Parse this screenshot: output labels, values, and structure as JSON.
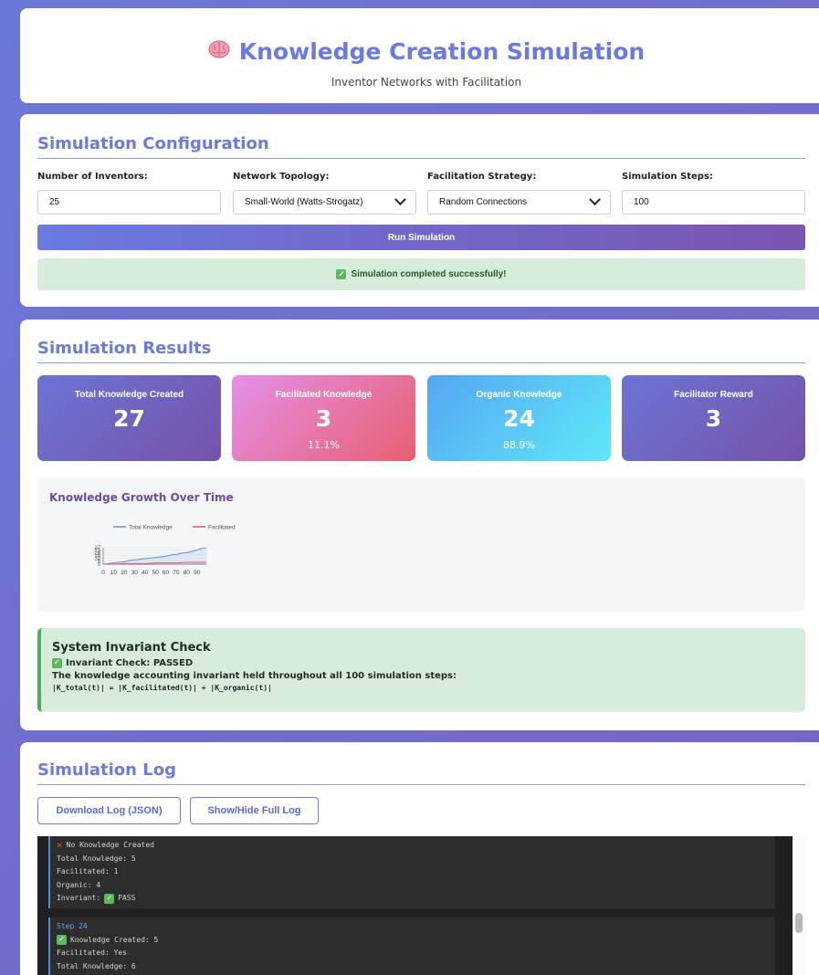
{
  "header": {
    "title": "Knowledge Creation Simulation",
    "subtitle": "Inventor Networks with Facilitation",
    "icon": "brain-icon"
  },
  "config": {
    "title": "Simulation Configuration",
    "fields": [
      {
        "label": "Number of Inventors:",
        "value": "25"
      },
      {
        "label": "Network Topology:",
        "value": "Small-World (Watts-Strogatz)"
      },
      {
        "label": "Facilitation Strategy:",
        "value": "Random Connections"
      },
      {
        "label": "Simulation Steps:",
        "value": "100"
      }
    ],
    "run_label": "Run Simulation",
    "status": "Simulation completed successfully!"
  },
  "results": {
    "title": "Simulation Results",
    "stats": [
      {
        "label": "Total Knowledge Created",
        "value": "27",
        "pct": ""
      },
      {
        "label": "Facilitated Knowledge",
        "value": "3",
        "pct": "11.1%"
      },
      {
        "label": "Organic Knowledge",
        "value": "24",
        "pct": "88.9%"
      },
      {
        "label": "Facilitator Reward",
        "value": "3",
        "pct": ""
      }
    ],
    "chart_title": "Knowledge Growth Over Time",
    "invariant": {
      "title": "System Invariant Check",
      "status": "Invariant Check: PASSED",
      "desc": "The knowledge accounting invariant held throughout all 100 simulation steps:",
      "formula": "|K_total(t)| = |K_facilitated(t)| + |K_organic(t)|"
    }
  },
  "chart_data": {
    "type": "line",
    "title": "Knowledge Growth Over Time",
    "xlabel": "",
    "ylabel": "",
    "x_ticks": [
      "0",
      "10",
      "20",
      "30",
      "40",
      "50",
      "60",
      "70",
      "80",
      "90"
    ],
    "y_ticks": [
      "0",
      "5",
      "10",
      "14",
      "18",
      "23",
      "27"
    ],
    "xlim": [
      0,
      99
    ],
    "ylim": [
      0,
      27
    ],
    "legend_position": "top",
    "series": [
      {
        "name": "Total Knowledge",
        "color": "#5b8def",
        "x": [
          0,
          5,
          10,
          15,
          20,
          25,
          30,
          35,
          40,
          45,
          50,
          55,
          60,
          65,
          70,
          75,
          80,
          85,
          90,
          95,
          99
        ],
        "values": [
          0,
          1,
          2,
          3,
          4,
          6,
          7,
          8,
          9,
          10,
          11,
          12,
          13,
          15,
          16,
          18,
          19,
          21,
          23,
          26,
          27
        ]
      },
      {
        "name": "Facilitated",
        "color": "#e05a66",
        "x": [
          0,
          10,
          20,
          30,
          40,
          50,
          60,
          70,
          80,
          90,
          99
        ],
        "values": [
          0,
          0,
          1,
          1,
          1,
          2,
          2,
          2,
          3,
          3,
          3
        ]
      }
    ]
  },
  "log": {
    "title": "Simulation Log",
    "download_label": "Download Log (JSON)",
    "toggle_label": "Show/Hide Full Log",
    "entry1": {
      "status": "No Knowledge Created",
      "total": "Total Knowledge: 5",
      "facilitated": "Facilitated: 1",
      "organic": "Organic: 4",
      "invariant_prefix": "Invariant:",
      "invariant_value": "PASS"
    },
    "entry2": {
      "step": "Step 24",
      "status": "Knowledge Created: 5",
      "facilitated": "Facilitated: Yes",
      "total": "Total Knowledge: 6"
    }
  }
}
